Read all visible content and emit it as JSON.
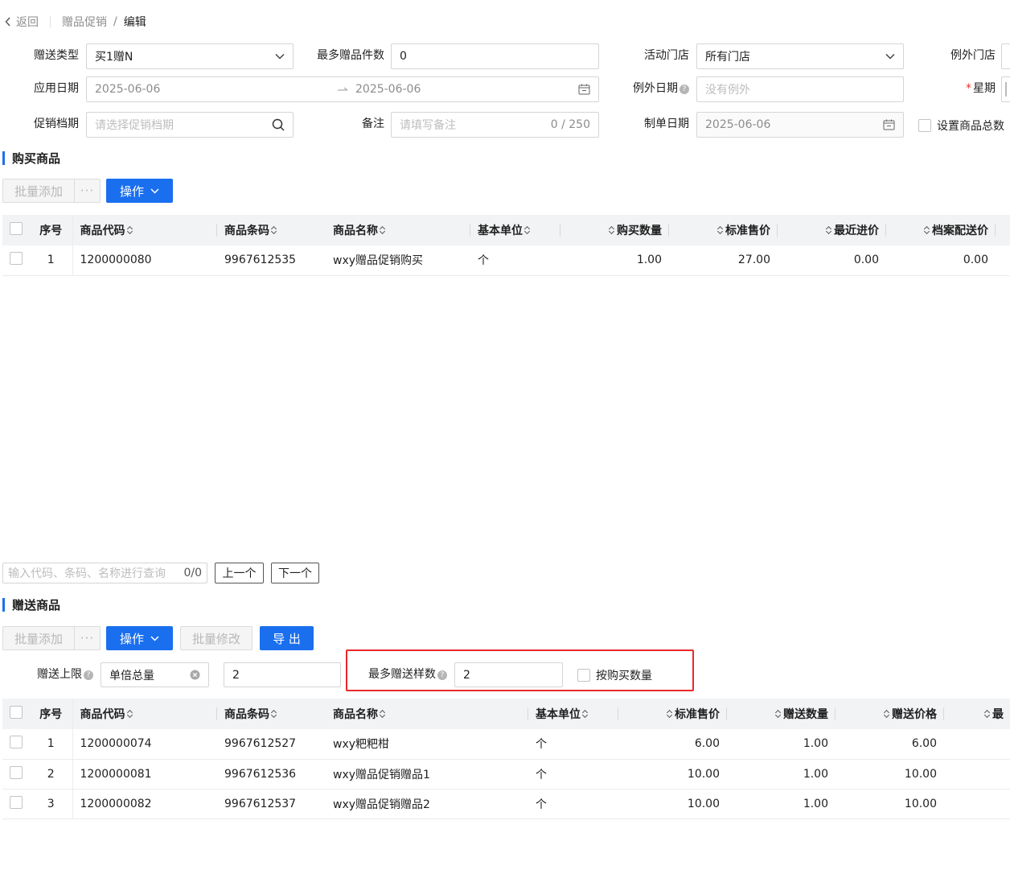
{
  "breadcrumb": {
    "back": "返回",
    "parent": "赠品促销",
    "current": "编辑"
  },
  "form": {
    "gift_type": {
      "label": "赠送类型",
      "value": "买1赠N"
    },
    "max_gift_count": {
      "label": "最多赠品件数",
      "value": "0"
    },
    "store": {
      "label": "活动门店",
      "value": "所有门店"
    },
    "exception_store": {
      "label": "例外门店"
    },
    "apply_date": {
      "label": "应用日期",
      "start": "2025-06-06",
      "end": "2025-06-06"
    },
    "exception_date": {
      "label": "例外日期",
      "placeholder": "没有例外"
    },
    "weekday": {
      "label": "星期",
      "required_mark": "*"
    },
    "promo_period": {
      "label": "促销档期",
      "placeholder": "请选择促销档期"
    },
    "remark": {
      "label": "备注",
      "placeholder": "请填写备注",
      "counter": "0 / 250"
    },
    "order_date": {
      "label": "制单日期",
      "value": "2025-06-06"
    },
    "set_total": {
      "label": "设置商品总数"
    }
  },
  "purchase": {
    "title": "购买商品",
    "batch_add": "批量添加",
    "more": "···",
    "operate": "操作",
    "columns": [
      "序号",
      "商品代码",
      "商品条码",
      "商品名称",
      "基本单位",
      "购买数量",
      "标准售价",
      "最近进价",
      "档案配送价"
    ],
    "rows": [
      {
        "seq": "1",
        "code": "1200000080",
        "barcode": "9967612535",
        "name": "wxy赠品促销购买",
        "unit": "个",
        "qty": "1.00",
        "price": "27.00",
        "last_cost": "0.00",
        "dist_price": "0.00"
      }
    ],
    "search_placeholder": "输入代码、条码、名称进行查询",
    "search_count": "0/0",
    "prev": "上一个",
    "next": "下一个"
  },
  "gift": {
    "title": "赠送商品",
    "batch_add": "批量添加",
    "more": "···",
    "operate": "操作",
    "batch_edit": "批量修改",
    "export": "导 出",
    "limit_label": "赠送上限",
    "limit_type": "单倍总量",
    "limit_value": "2",
    "max_types_label": "最多赠送样数",
    "max_types_value": "2",
    "by_purchase_label": "按购买数量",
    "columns": [
      "序号",
      "商品代码",
      "商品条码",
      "商品名称",
      "基本单位",
      "标准售价",
      "赠送数量",
      "赠送价格",
      "最"
    ],
    "rows": [
      {
        "seq": "1",
        "code": "1200000074",
        "barcode": "9967612527",
        "name": "wxy粑粑柑",
        "unit": "个",
        "price": "6.00",
        "qty": "1.00",
        "gift_price": "6.00"
      },
      {
        "seq": "2",
        "code": "1200000081",
        "barcode": "9967612536",
        "name": "wxy赠品促销赠品1",
        "unit": "个",
        "price": "10.00",
        "qty": "1.00",
        "gift_price": "10.00"
      },
      {
        "seq": "3",
        "code": "1200000082",
        "barcode": "9967612537",
        "name": "wxy赠品促销赠品2",
        "unit": "个",
        "price": "10.00",
        "qty": "1.00",
        "gift_price": "10.00"
      }
    ]
  },
  "colors": {
    "primary": "#1a6fee",
    "highlight": "#e8282b",
    "header_bg": "#f2f3f5"
  }
}
